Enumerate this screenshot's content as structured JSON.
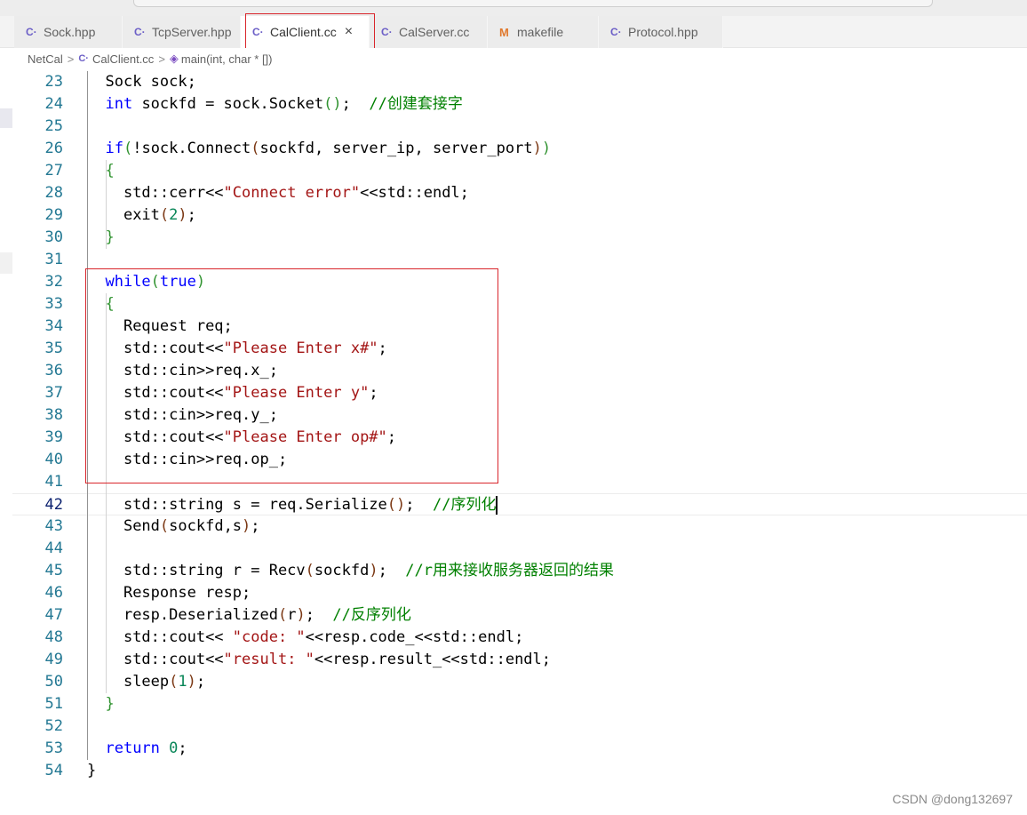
{
  "tabs": [
    {
      "label": "Sock.hpp",
      "icon": "cpp-file-icon",
      "glyph": "C·"
    },
    {
      "label": "TcpServer.hpp",
      "icon": "cpp-file-icon",
      "glyph": "C·"
    },
    {
      "label": "CalClient.cc",
      "icon": "cpp-file-icon",
      "glyph": "C·",
      "active": true,
      "close": "×"
    },
    {
      "label": "CalServer.cc",
      "icon": "cpp-file-icon",
      "glyph": "C·"
    },
    {
      "label": "makefile",
      "icon": "makefile-icon",
      "glyph": "M"
    },
    {
      "label": "Protocol.hpp",
      "icon": "cpp-file-icon",
      "glyph": "C·"
    }
  ],
  "breadcrumb": {
    "folder": "NetCal",
    "file": "CalClient.cc",
    "symbol": "main(int, char * [])",
    "separator": ">"
  },
  "editor": {
    "current_line": 42,
    "lines": [
      {
        "n": "23",
        "indent": "  ",
        "tokens": [
          [
            "p",
            "Sock sock;"
          ]
        ]
      },
      {
        "n": "24",
        "indent": "  ",
        "tokens": [
          [
            "kw",
            "int"
          ],
          [
            "p",
            " sockfd = sock.Socket"
          ],
          [
            "b1",
            "()"
          ],
          [
            "p",
            ";  "
          ],
          [
            "cmt",
            "//创建套接字"
          ]
        ]
      },
      {
        "n": "25",
        "indent": "",
        "tokens": []
      },
      {
        "n": "26",
        "indent": "  ",
        "tokens": [
          [
            "kw",
            "if"
          ],
          [
            "b1",
            "("
          ],
          [
            "p",
            "!sock.Connect"
          ],
          [
            "b2",
            "("
          ],
          [
            "p",
            "sockfd, server_ip, server_port"
          ],
          [
            "b2",
            ")"
          ],
          [
            "b1",
            ")"
          ]
        ]
      },
      {
        "n": "27",
        "indent": "  ",
        "tokens": [
          [
            "b1",
            "{"
          ]
        ]
      },
      {
        "n": "28",
        "indent": "    ",
        "tokens": [
          [
            "p",
            "std::cerr<<"
          ],
          [
            "str",
            "\"Connect error\""
          ],
          [
            "p",
            "<<std::endl;"
          ]
        ]
      },
      {
        "n": "29",
        "indent": "    ",
        "tokens": [
          [
            "p",
            "exit"
          ],
          [
            "b2",
            "("
          ],
          [
            "num",
            "2"
          ],
          [
            "b2",
            ")"
          ],
          [
            "p",
            ";"
          ]
        ]
      },
      {
        "n": "30",
        "indent": "  ",
        "tokens": [
          [
            "b1",
            "}"
          ]
        ]
      },
      {
        "n": "31",
        "indent": "",
        "tokens": []
      },
      {
        "n": "32",
        "indent": "  ",
        "tokens": [
          [
            "kw",
            "while"
          ],
          [
            "b1",
            "("
          ],
          [
            "kw",
            "true"
          ],
          [
            "b1",
            ")"
          ]
        ]
      },
      {
        "n": "33",
        "indent": "  ",
        "tokens": [
          [
            "b1",
            "{"
          ]
        ]
      },
      {
        "n": "34",
        "indent": "    ",
        "tokens": [
          [
            "p",
            "Request req;"
          ]
        ]
      },
      {
        "n": "35",
        "indent": "    ",
        "tokens": [
          [
            "p",
            "std::cout<<"
          ],
          [
            "str",
            "\"Please Enter x#\""
          ],
          [
            "p",
            ";"
          ]
        ]
      },
      {
        "n": "36",
        "indent": "    ",
        "tokens": [
          [
            "p",
            "std::cin>>req.x_;"
          ]
        ]
      },
      {
        "n": "37",
        "indent": "    ",
        "tokens": [
          [
            "p",
            "std::cout<<"
          ],
          [
            "str",
            "\"Please Enter y\""
          ],
          [
            "p",
            ";"
          ]
        ]
      },
      {
        "n": "38",
        "indent": "    ",
        "tokens": [
          [
            "p",
            "std::cin>>req.y_;"
          ]
        ]
      },
      {
        "n": "39",
        "indent": "    ",
        "tokens": [
          [
            "p",
            "std::cout<<"
          ],
          [
            "str",
            "\"Please Enter op#\""
          ],
          [
            "p",
            ";"
          ]
        ]
      },
      {
        "n": "40",
        "indent": "    ",
        "tokens": [
          [
            "p",
            "std::cin>>req.op_;"
          ]
        ]
      },
      {
        "n": "41",
        "indent": "",
        "tokens": []
      },
      {
        "n": "42",
        "indent": "    ",
        "tokens": [
          [
            "p",
            "std::string s = req.Serialize"
          ],
          [
            "b2",
            "()"
          ],
          [
            "p",
            ";  "
          ],
          [
            "cmt",
            "//序列化"
          ]
        ],
        "cursor": true
      },
      {
        "n": "43",
        "indent": "    ",
        "tokens": [
          [
            "p",
            "Send"
          ],
          [
            "b2",
            "("
          ],
          [
            "p",
            "sockfd,s"
          ],
          [
            "b2",
            ")"
          ],
          [
            "p",
            ";"
          ]
        ]
      },
      {
        "n": "44",
        "indent": "",
        "tokens": []
      },
      {
        "n": "45",
        "indent": "    ",
        "tokens": [
          [
            "p",
            "std::string r = Recv"
          ],
          [
            "b2",
            "("
          ],
          [
            "p",
            "sockfd"
          ],
          [
            "b2",
            ")"
          ],
          [
            "p",
            ";  "
          ],
          [
            "cmt",
            "//r用来接收服务器返回的结果"
          ]
        ]
      },
      {
        "n": "46",
        "indent": "    ",
        "tokens": [
          [
            "p",
            "Response resp;"
          ]
        ]
      },
      {
        "n": "47",
        "indent": "    ",
        "tokens": [
          [
            "p",
            "resp.Deserialized"
          ],
          [
            "b2",
            "("
          ],
          [
            "p",
            "r"
          ],
          [
            "b2",
            ")"
          ],
          [
            "p",
            ";  "
          ],
          [
            "cmt",
            "//反序列化"
          ]
        ]
      },
      {
        "n": "48",
        "indent": "    ",
        "tokens": [
          [
            "p",
            "std::cout<< "
          ],
          [
            "str",
            "\"code: \""
          ],
          [
            "p",
            "<<resp.code_<<std::endl;"
          ]
        ]
      },
      {
        "n": "49",
        "indent": "    ",
        "tokens": [
          [
            "p",
            "std::cout<<"
          ],
          [
            "str",
            "\"result: \""
          ],
          [
            "p",
            "<<resp.result_<<std::endl;"
          ]
        ]
      },
      {
        "n": "50",
        "indent": "    ",
        "tokens": [
          [
            "p",
            "sleep"
          ],
          [
            "b2",
            "("
          ],
          [
            "num",
            "1"
          ],
          [
            "b2",
            ")"
          ],
          [
            "p",
            ";"
          ]
        ]
      },
      {
        "n": "51",
        "indent": "  ",
        "tokens": [
          [
            "b1",
            "}"
          ]
        ]
      },
      {
        "n": "52",
        "indent": "",
        "tokens": []
      },
      {
        "n": "53",
        "indent": "  ",
        "tokens": [
          [
            "kw",
            "return"
          ],
          [
            "p",
            " "
          ],
          [
            "num",
            "0"
          ],
          [
            "p",
            ";"
          ]
        ]
      },
      {
        "n": "54",
        "indent": "",
        "tokens": [
          [
            "p",
            "}"
          ]
        ]
      }
    ]
  },
  "watermark": "CSDN @dong132697",
  "colors": {
    "keyword": "#0000ff",
    "string": "#a31515",
    "number": "#098658",
    "comment": "#008000",
    "line_number": "#237893",
    "highlight_box": "#d9252b"
  }
}
